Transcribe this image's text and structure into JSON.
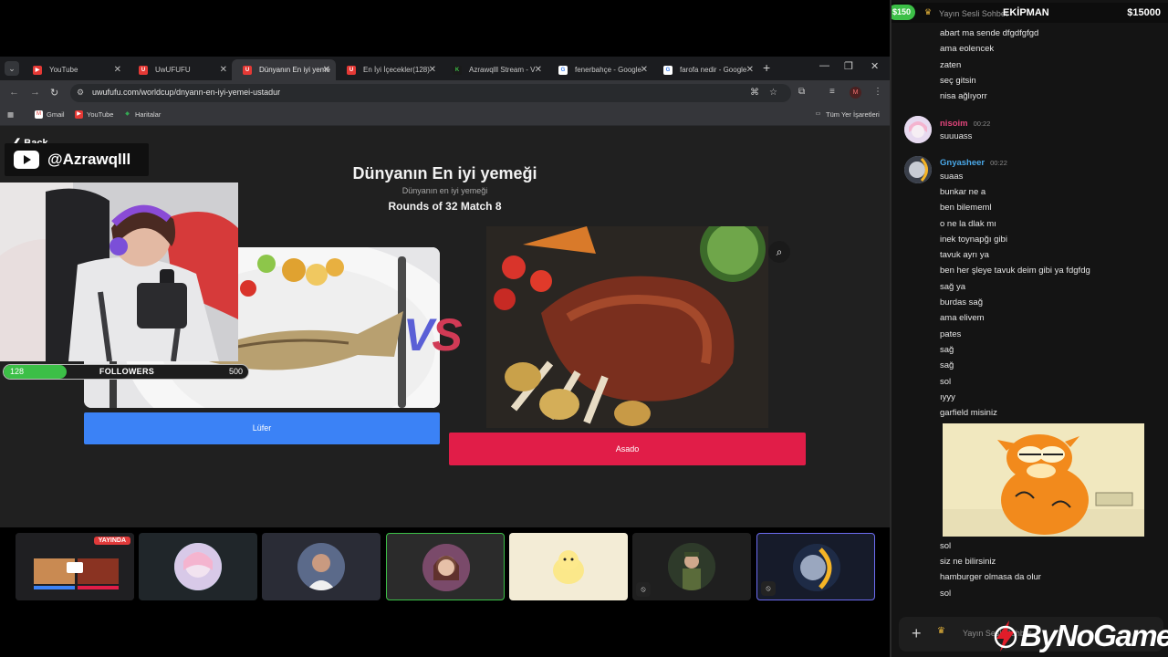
{
  "browser": {
    "tabs": [
      {
        "label": "YouTube",
        "fav_color": "#e53935",
        "fav_glyph": "▶"
      },
      {
        "label": "UwUFUFU",
        "fav_color": "#e53935",
        "fav_glyph": "U"
      },
      {
        "label": "Dünyanın En iyi yeme",
        "fav_color": "#e53935",
        "fav_glyph": "U"
      },
      {
        "label": "En İyi İçecekler(128)",
        "fav_color": "#e53935",
        "fav_glyph": "U"
      },
      {
        "label": "Azrawqlll Stream - V",
        "fav_color": "#3cbf47",
        "fav_glyph": "K"
      },
      {
        "label": "fenerbahçe - Google",
        "fav_color": "#ffffff",
        "fav_glyph": "G"
      },
      {
        "label": "farofa nedir - Google",
        "fav_color": "#ffffff",
        "fav_glyph": "G"
      }
    ],
    "url": "uwufufu.com/worldcup/dnyann-en-iyi-yemei-ustadur",
    "bookmarks": [
      {
        "label": "Gmail",
        "color": "#e53935",
        "glyph": "M"
      },
      {
        "label": "YouTube",
        "color": "#e53935",
        "glyph": "▶"
      },
      {
        "label": "Haritalar",
        "color": "#34a853",
        "glyph": "◆"
      }
    ],
    "all_bookmarks": "Tüm Yer İşaretleri",
    "avatar_letter": "M"
  },
  "page": {
    "back": "Back",
    "title": "Dünyanın En iyi yemeği",
    "subtitle": "Dünyanın en iyi yemeği",
    "round": "Rounds of 32 Match 8",
    "vs_v": "V",
    "vs_s": "S",
    "left_choice": "Lüfer",
    "right_choice": "Asado"
  },
  "overlay": {
    "channel": "@Azrawqlll",
    "followers_current": "128",
    "followers_label": "FOLLOWERS",
    "followers_goal": "500",
    "followers_progress": 0.256
  },
  "participants": {
    "live_label": "YAYINDA"
  },
  "chat": {
    "money": "$150",
    "channel": "Yayın Sesli Sohbet",
    "team": "EKİPMAN",
    "team_money": "$15000",
    "messages_top": [
      "abart ma sende dfgdfgfgd",
      "ama eolencek",
      "zaten",
      "seç gitsin",
      "nisa ağlıyorr"
    ],
    "user1": {
      "name": "nisoim",
      "time": "00:22",
      "color": "#e0457b",
      "messages": [
        "suuuass"
      ]
    },
    "user2": {
      "name": "Gnyasheer",
      "time": "00:22",
      "color": "#4aa8e8",
      "messages": [
        "suaas",
        "bunkar ne a",
        "ben bilememl",
        "o ne la dlak mı",
        "inek toynapğı gibi",
        "tavuk ayrı ya",
        "ben her şleye tavuk deim gibi ya fdgfdg",
        "sağ ya",
        "burdas sağ",
        "ama elivem",
        "pates",
        "sağ",
        "sağ",
        "sol",
        "ıyyy",
        "garfield misiniz"
      ]
    },
    "messages_bottom": [
      "sol",
      "siz ne bilirsiniz",
      "hamburger olmasa da olur",
      "sol"
    ],
    "input_placeholder": "Yayın Sesli Sohbet",
    "brand": "ByNoGame"
  }
}
